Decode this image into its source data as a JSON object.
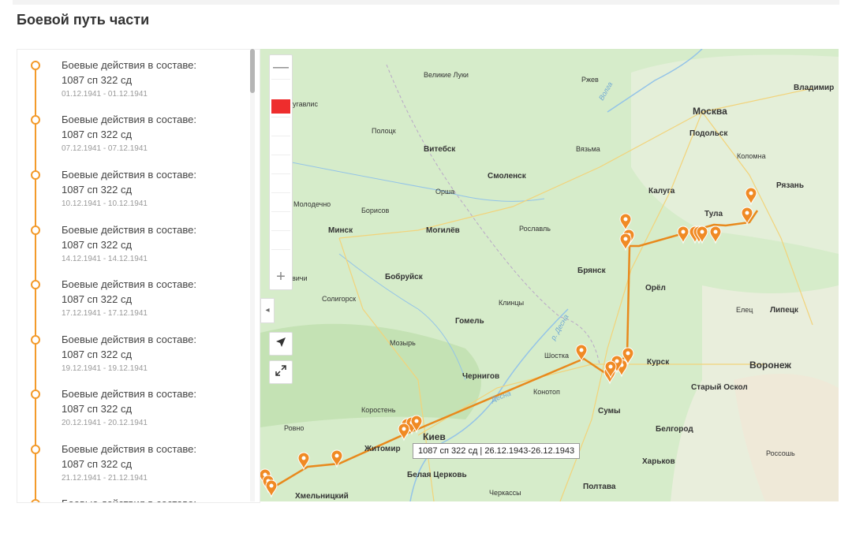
{
  "page": {
    "title": "Боевой путь части"
  },
  "timeline": [
    {
      "title": "Боевые действия в составе:",
      "unit": "1087 сп 322 сд",
      "dates": "01.12.1941 - 01.12.1941"
    },
    {
      "title": "Боевые действия в составе:",
      "unit": "1087 сп 322 сд",
      "dates": "07.12.1941 - 07.12.1941"
    },
    {
      "title": "Боевые действия в составе:",
      "unit": "1087 сп 322 сд",
      "dates": "10.12.1941 - 10.12.1941"
    },
    {
      "title": "Боевые действия в составе:",
      "unit": "1087 сп 322 сд",
      "dates": "14.12.1941 - 14.12.1941"
    },
    {
      "title": "Боевые действия в составе:",
      "unit": "1087 сп 322 сд",
      "dates": "17.12.1941 - 17.12.1941"
    },
    {
      "title": "Боевые действия в составе:",
      "unit": "1087 сп 322 сд",
      "dates": "19.12.1941 - 19.12.1941"
    },
    {
      "title": "Боевые действия в составе:",
      "unit": "1087 сп 322 сд",
      "dates": "20.12.1941 - 20.12.1941"
    },
    {
      "title": "Боевые действия в составе:",
      "unit": "1087 сп 322 сд",
      "dates": "21.12.1941 - 21.12.1941"
    },
    {
      "title": "Боевые действия в составе:",
      "unit": "",
      "dates": ""
    }
  ],
  "map": {
    "cities": {
      "moscow": "Москва",
      "podolsk": "Подольск",
      "kolomna": "Коломна",
      "ryazan": "Рязань",
      "vladimir": "Vladimir",
      "rzhev": "Ржев",
      "vyazma": "Вязьма",
      "kaluga": "Калуга",
      "tula": "Тула",
      "smolensk": "Смоленск",
      "vitebsk": "Витебск",
      "polotsk": "Полоцк",
      "velikie_luki": "Великие Луки",
      "orsha": "Орша",
      "molodechno": "Молодечно",
      "borisov": "Борисов",
      "minsk": "Минск",
      "mogilev": "Могилёв",
      "roslavl": "Рославль",
      "bryansk": "Брянск",
      "orel": "Орёл",
      "elets": "Елец",
      "lipetsk": "Липецк",
      "bobruysk": "Бобруйск",
      "soligorsk": "Солигорск",
      "klintsy": "Клинцы",
      "gomel": "Гомель",
      "mozyr": "Мозырь",
      "shostka": "Шостка",
      "kursk": "Курск",
      "voronezh": "Воронеж",
      "chernigov": "Чернигов",
      "konotop": "Конотоп",
      "stary_oskol": "Старый Оскол",
      "korosten": "Коростень",
      "sumy": "Сумы",
      "rovno": "Ровно",
      "kiev": "Киев",
      "belgorod": "Белгород",
      "zhitomir": "Житомир",
      "kharkov": "Харьков",
      "rossosh": "Россошь",
      "belaya_tserkov": "Белая Церковь",
      "poltava": "Полтава",
      "khmelnitsky": "Хмельницкий",
      "cherkassy": "Черкассы",
      "zubtsov": "угавлис",
      "vichi": "вичи"
    },
    "rivers": {
      "volga": "Волга",
      "desna": "р. Десна",
      "desna2": "Десна"
    },
    "tooltip": "1087 сп 322 сд | 26.12.1943-26.12.1943",
    "zoom_in": "+",
    "zoom_out": "—",
    "collapse": "◂",
    "route_color": "#e8891c",
    "marker_color": "#f08a24"
  }
}
